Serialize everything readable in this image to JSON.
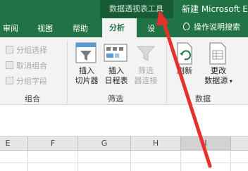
{
  "titlebar": {
    "context_tab_title": "数据透视表工具",
    "document_title": "新建 Microsoft E"
  },
  "tabs": [
    {
      "label": "审阅"
    },
    {
      "label": "视图"
    },
    {
      "label": "帮助"
    },
    {
      "label": "分析",
      "active": true
    },
    {
      "label": "设"
    }
  ],
  "tell_me": "操作说明搜索",
  "ribbon": {
    "group_items": [
      "分组选择",
      "取消组合",
      "分组字段"
    ],
    "group_label": "组合",
    "insert_slicer": [
      "插入",
      "切片器"
    ],
    "insert_timeline": [
      "插入",
      "日程表"
    ],
    "filter_connections": [
      "筛选",
      "器连接"
    ],
    "filter_label": "筛选",
    "refresh": "刷新",
    "change_source": [
      "更改",
      "数据源"
    ],
    "data_label": "数据"
  },
  "columns": [
    "E",
    "F",
    "G",
    "H",
    "I"
  ],
  "colors": {
    "excel_green": "#217346",
    "arrow_red": "#e5302b"
  }
}
